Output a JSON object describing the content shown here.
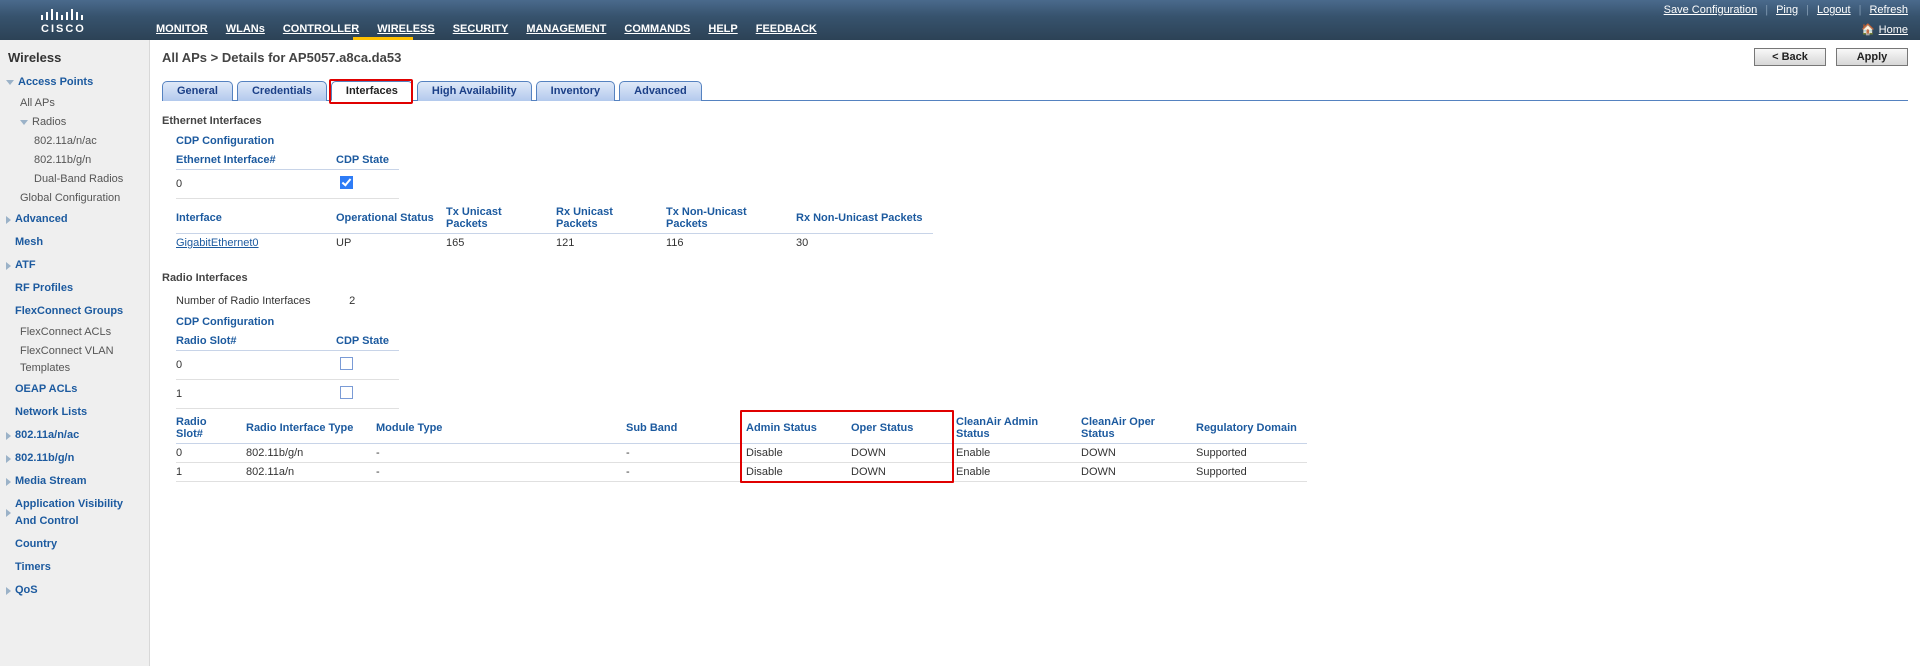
{
  "header": {
    "nav": {
      "monitor": "MONITOR",
      "wlans": "WLANs",
      "controller": "CONTROLLER",
      "wireless": "WIRELESS",
      "security": "SECURITY",
      "management": "MANAGEMENT",
      "commands": "COMMANDS",
      "help": "HELP",
      "feedback": "FEEDBACK"
    },
    "top_right": {
      "save": "Save Configuration",
      "ping": "Ping",
      "logout": "Logout",
      "refresh": "Refresh"
    },
    "home": "Home"
  },
  "sidebar": {
    "title": "Wireless",
    "items": [
      {
        "label": "Access Points",
        "expanded": true,
        "children": [
          {
            "label": "All APs"
          },
          {
            "label": "Radios",
            "expanded": true,
            "children": [
              {
                "label": "802.11a/n/ac"
              },
              {
                "label": "802.11b/g/n"
              },
              {
                "label": "Dual-Band Radios"
              }
            ]
          },
          {
            "label": "Global Configuration"
          }
        ]
      },
      {
        "label": "Advanced"
      },
      {
        "label": "Mesh",
        "noarrow": true
      },
      {
        "label": "ATF"
      },
      {
        "label": "RF Profiles",
        "noarrow": true
      },
      {
        "label": "FlexConnect Groups",
        "noarrow": true,
        "children": [
          {
            "label": "FlexConnect ACLs"
          },
          {
            "label": "FlexConnect VLAN Templates"
          }
        ]
      },
      {
        "label": "OEAP ACLs",
        "noarrow": true
      },
      {
        "label": "Network Lists",
        "noarrow": true
      },
      {
        "label": "802.11a/n/ac"
      },
      {
        "label": "802.11b/g/n"
      },
      {
        "label": "Media Stream"
      },
      {
        "label": "Application Visibility And Control"
      },
      {
        "label": "Country",
        "noarrow": true
      },
      {
        "label": "Timers",
        "noarrow": true
      },
      {
        "label": "QoS"
      }
    ]
  },
  "main": {
    "title": "All APs > Details for AP5057.a8ca.da53",
    "back_btn": "< Back",
    "apply_btn": "Apply",
    "tabs": {
      "general": "General",
      "credentials": "Credentials",
      "interfaces": "Interfaces",
      "high_availability": "High Availability",
      "inventory": "Inventory",
      "advanced": "Advanced"
    },
    "ethernet": {
      "title": "Ethernet Interfaces",
      "cdp_title": "CDP Configuration",
      "cdp_th1": "Ethernet Interface#",
      "cdp_th2": "CDP State",
      "cdp_row0_iface": "0",
      "cdp_row0_checked": true,
      "stats_th": {
        "interface": "Interface",
        "oper": "Operational Status",
        "tx_uni": "Tx Unicast Packets",
        "rx_uni": "Rx Unicast Packets",
        "tx_non": "Tx Non-Unicast Packets",
        "rx_non": "Rx Non-Unicast Packets"
      },
      "stats_rows": [
        {
          "interface": "GigabitEthernet0",
          "oper": "UP",
          "tx_uni": "165",
          "rx_uni": "121",
          "tx_non": "116",
          "rx_non": "30"
        }
      ]
    },
    "radio": {
      "title": "Radio Interfaces",
      "num_label": "Number of Radio Interfaces",
      "num_value": "2",
      "cdp_title": "CDP Configuration",
      "cdp_th1": "Radio Slot#",
      "cdp_th2": "CDP State",
      "cdp_rows": [
        {
          "slot": "0",
          "checked": false
        },
        {
          "slot": "1",
          "checked": false
        }
      ],
      "th": {
        "slot": "Radio Slot#",
        "type": "Radio Interface Type",
        "module": "Module Type",
        "subband": "Sub Band",
        "admin": "Admin Status",
        "oper": "Oper Status",
        "ca_admin": "CleanAir Admin Status",
        "ca_oper": "CleanAir Oper Status",
        "reg": "Regulatory Domain"
      },
      "rows": [
        {
          "slot": "0",
          "type": "802.11b/g/n",
          "module": "-",
          "subband": "-",
          "admin": "Disable",
          "oper": "DOWN",
          "ca_admin": "Enable",
          "ca_oper": "DOWN",
          "reg": "Supported"
        },
        {
          "slot": "1",
          "type": "802.11a/n",
          "module": "-",
          "subband": "-",
          "admin": "Disable",
          "oper": "DOWN",
          "ca_admin": "Enable",
          "ca_oper": "DOWN",
          "reg": "Supported"
        }
      ]
    }
  }
}
